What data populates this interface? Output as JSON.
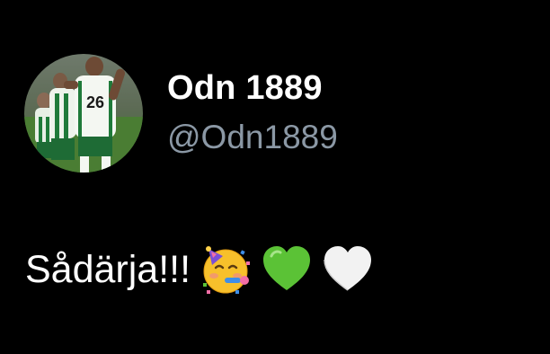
{
  "author": {
    "display_name": "Odn 1889",
    "handle": "@Odn1889",
    "avatar_icon": "player-celebration-photo",
    "jersey_number": "26"
  },
  "tweet": {
    "text": "Sådärja!!!",
    "emojis": [
      "partying-face-icon",
      "green-heart-icon",
      "white-heart-icon"
    ]
  },
  "colors": {
    "background": "#000000",
    "name": "#ffffff",
    "handle": "#8b98a5",
    "green_heart": "#5bc236",
    "white_heart": "#f2f2f2"
  }
}
